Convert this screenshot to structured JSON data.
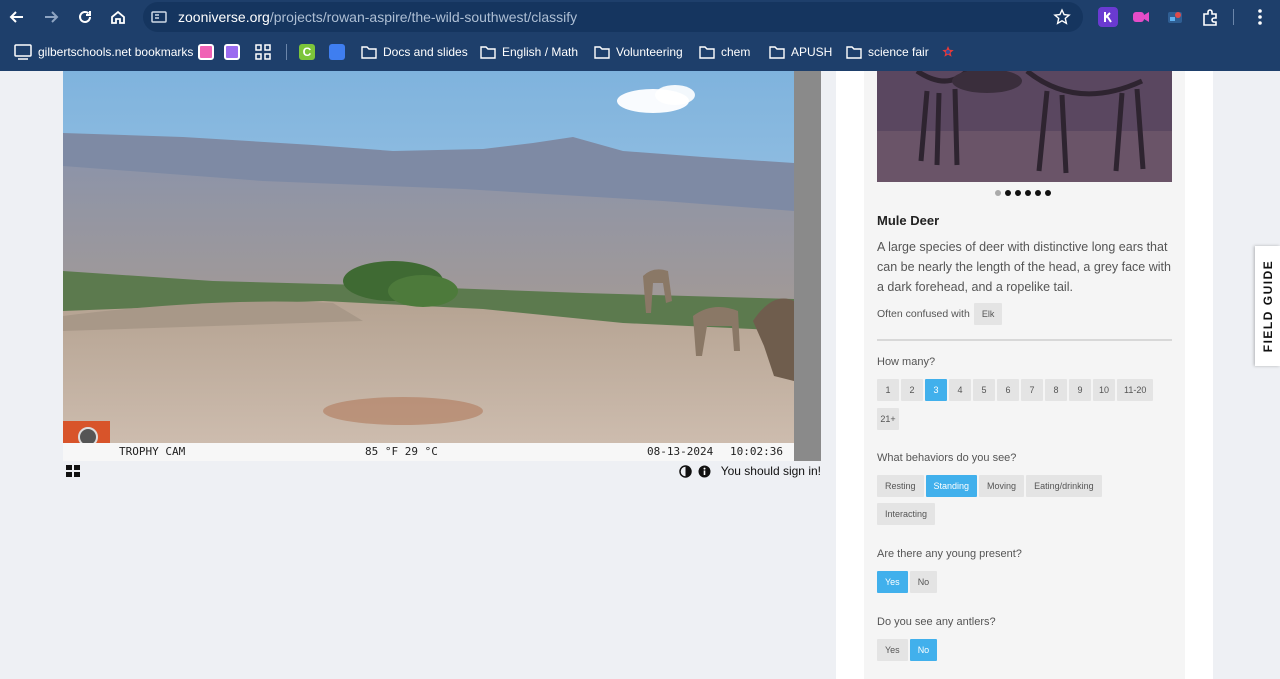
{
  "browser": {
    "url_host": "zooniverse.org",
    "url_path": "/projects/rowan-aspire/the-wild-southwest/classify",
    "bookmarks": [
      {
        "label": "gilbertschools.net bookmarks"
      },
      {
        "label": "Docs and slides"
      },
      {
        "label": "English / Math"
      },
      {
        "label": "Volunteering"
      },
      {
        "label": "chem"
      },
      {
        "label": "APUSH"
      },
      {
        "label": "science fair"
      }
    ]
  },
  "camera": {
    "brand": "Bushnell",
    "model": "TROPHY CAM",
    "temperature": "85 °F 29 °C",
    "date": "08-13-2024",
    "time": "10:02:36"
  },
  "subject_tools": {
    "sign_in_text": "You should sign in!"
  },
  "field_guide_tab": "FIELD GUIDE",
  "species": {
    "name": "Mule Deer",
    "description": "A large species of deer with distinctive long ears that can be nearly the length of the head, a grey face with a dark forehead, and a ropelike tail.",
    "confused_label": "Often confused with",
    "confused_with": "Elk"
  },
  "questions": {
    "how_many": {
      "label": "How many?",
      "options": [
        "1",
        "2",
        "3",
        "4",
        "5",
        "6",
        "7",
        "8",
        "9",
        "10",
        "11-20",
        "21+"
      ],
      "selected": "3"
    },
    "behaviors": {
      "label": "What behaviors do you see?",
      "options": [
        "Resting",
        "Standing",
        "Moving",
        "Eating/drinking",
        "Interacting"
      ],
      "selected": "Standing"
    },
    "young": {
      "label": "Are there any young present?",
      "options": [
        "Yes",
        "No"
      ],
      "selected": "Yes"
    },
    "antlers": {
      "label": "Do you see any antlers?",
      "options": [
        "Yes",
        "No"
      ],
      "selected": "No"
    }
  },
  "colors": {
    "chrome": "#1e3f6b",
    "selected_chip": "#41b0ec",
    "page_bg": "#eef0f4"
  }
}
